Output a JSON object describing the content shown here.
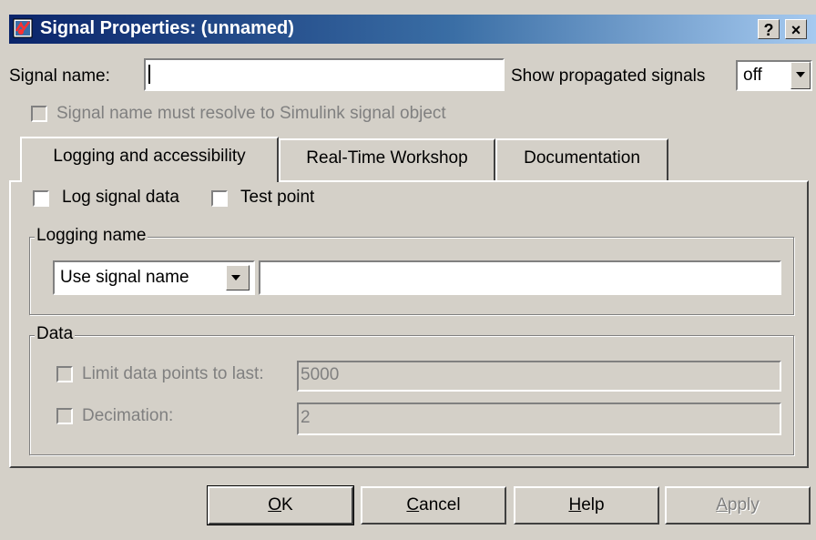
{
  "window": {
    "title": "Signal Properties: (unnamed)",
    "help_button": "?",
    "close_button": "×"
  },
  "signal_name": {
    "label": "Signal name:",
    "value": ""
  },
  "propagated": {
    "label": "Show propagated signals",
    "value": "off"
  },
  "resolve_checkbox": {
    "label": "Signal name must resolve to Simulink signal object",
    "checked": false,
    "enabled": false
  },
  "tabs": [
    {
      "label": "Logging and accessibility",
      "active": true
    },
    {
      "label": "Real-Time Workshop",
      "active": false
    },
    {
      "label": "Documentation",
      "active": false
    }
  ],
  "logging": {
    "log_signal_label": "Log signal data",
    "log_signal_checked": false,
    "test_point_label": "Test point",
    "test_point_checked": false,
    "group_title": "Logging name",
    "mode_value": "Use signal name",
    "name_value": ""
  },
  "data": {
    "group_title": "Data",
    "limit_label": "Limit data points to last:",
    "limit_value": "5000",
    "limit_checked": false,
    "decimation_label": "Decimation:",
    "decimation_value": "2",
    "decimation_checked": false
  },
  "buttons": {
    "ok_mn": "O",
    "ok_rest": "K",
    "cancel_mn": "C",
    "cancel_rest": "ancel",
    "help_mn": "H",
    "help_rest": "elp",
    "apply_mn": "A",
    "apply_rest": "pply"
  },
  "colors": {
    "titlebar_start": "#0a246a",
    "titlebar_end": "#a6caf0",
    "face": "#d4d0c8"
  }
}
